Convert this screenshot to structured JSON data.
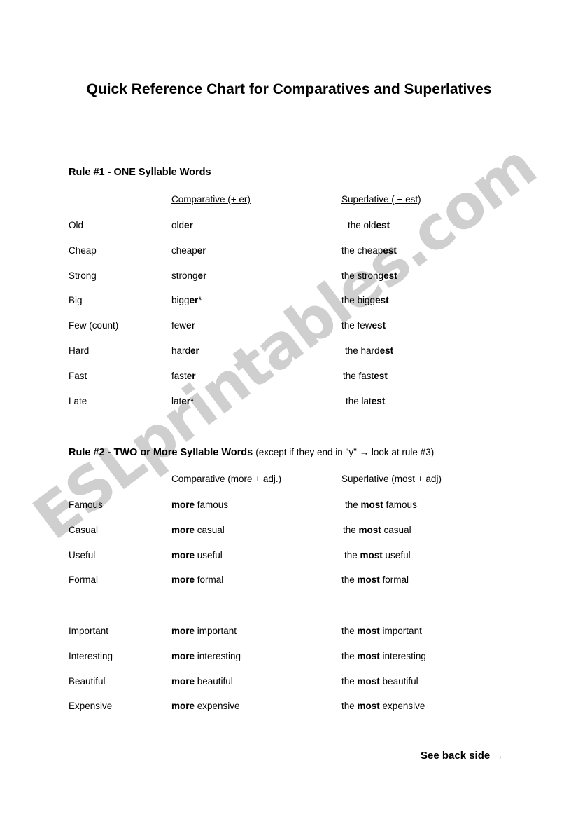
{
  "document": {
    "title": "Quick Reference Chart for Comparatives and Superlatives",
    "footer_note": "See back side →"
  },
  "watermark": {
    "text": "ESLprintables.com",
    "color": "#cfcfcf"
  },
  "rule1": {
    "heading": "Rule #1 - ONE Syllable Words",
    "headers": {
      "base": "",
      "comparative": "Comparative (+ er)",
      "superlative": "Superlative ( + est)"
    },
    "rows": [
      {
        "base": "Old",
        "comp_stem": "old",
        "comp_suffix": "er",
        "comp_mark": "",
        "sup_prefix": "the ",
        "sup_stem": "old",
        "sup_suffix": "est"
      },
      {
        "base": "Cheap",
        "comp_stem": "cheap",
        "comp_suffix": "er",
        "comp_mark": "",
        "sup_prefix": "the ",
        "sup_stem": "cheap",
        "sup_suffix": "est"
      },
      {
        "base": "Strong",
        "comp_stem": "strong",
        "comp_suffix": "er",
        "comp_mark": "",
        "sup_prefix": "the ",
        "sup_stem": "strong",
        "sup_suffix": "est"
      },
      {
        "base": "Big",
        "comp_stem": "bigg",
        "comp_suffix": "er",
        "comp_mark": "*",
        "sup_prefix": "the ",
        "sup_stem": "bigg",
        "sup_suffix": "est"
      },
      {
        "base": "Few (count)",
        "comp_stem": "few",
        "comp_suffix": "er",
        "comp_mark": "",
        "sup_prefix": "the ",
        "sup_stem": "few",
        "sup_suffix": "est"
      },
      {
        "base": "Hard",
        "comp_stem": "hard",
        "comp_suffix": "er",
        "comp_mark": "",
        "sup_prefix": "the ",
        "sup_stem": "hard",
        "sup_suffix": "est"
      },
      {
        "base": "Fast",
        "comp_stem": "fast",
        "comp_suffix": "er",
        "comp_mark": "",
        "sup_prefix": "the ",
        "sup_stem": "fast",
        "sup_suffix": "est"
      },
      {
        "base": "Late",
        "comp_stem": "lat",
        "comp_suffix": "er",
        "comp_mark": "*",
        "sup_prefix": "the ",
        "sup_stem": "lat",
        "sup_suffix": "est"
      }
    ]
  },
  "rule2": {
    "heading_bold": "Rule #2 - TWO or More Syllable Words",
    "heading_note": "(except if they end in \"y\"  → look at rule #3)",
    "headers": {
      "base": "",
      "comparative": "Comparative (more + adj.)",
      "superlative": "Superlative (most + adj)"
    },
    "rows_group1": [
      {
        "base": "Famous",
        "comp_bold": "more",
        "comp_rest": " famous",
        "sup_prefix": "the ",
        "sup_bold": "most",
        "sup_rest": " famous"
      },
      {
        "base": "Casual",
        "comp_bold": "more",
        "comp_rest": " casual",
        "sup_prefix": "the ",
        "sup_bold": "most",
        "sup_rest": " casual"
      },
      {
        "base": "Useful",
        "comp_bold": "more",
        "comp_rest": " useful",
        "sup_prefix": "the ",
        "sup_bold": "most",
        "sup_rest": " useful"
      },
      {
        "base": "Formal",
        "comp_bold": "more",
        "comp_rest": " formal",
        "sup_prefix": "the ",
        "sup_bold": "most",
        "sup_rest": " formal"
      }
    ],
    "rows_group2": [
      {
        "base": "Important",
        "comp_bold": "more",
        "comp_rest": " important",
        "sup_prefix": "the ",
        "sup_bold": "most",
        "sup_rest": " important"
      },
      {
        "base": "Interesting",
        "comp_bold": "more",
        "comp_rest": " interesting",
        "sup_prefix": "the ",
        "sup_bold": "most",
        "sup_rest": " interesting"
      },
      {
        "base": "Beautiful",
        "comp_bold": "more",
        "comp_rest": " beautiful",
        "sup_prefix": "the ",
        "sup_bold": "most",
        "sup_rest": " beautiful"
      },
      {
        "base": "Expensive",
        "comp_bold": "more",
        "comp_rest": " expensive",
        "sup_prefix": "the ",
        "sup_bold": "most",
        "sup_rest": " expensive"
      }
    ]
  }
}
